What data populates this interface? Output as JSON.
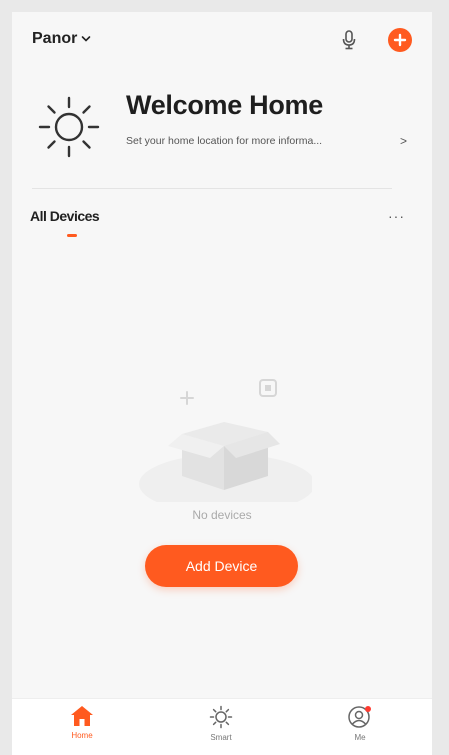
{
  "header": {
    "home_name": "Panor",
    "icons": {
      "dropdown": "chevron-down-icon",
      "mic": "microphone-icon",
      "add": "plus-circle-icon"
    }
  },
  "welcome": {
    "title": "Welcome Home",
    "subtitle": "Set your home location for more informa...",
    "arrow": ">",
    "icon": "sun-icon"
  },
  "devices": {
    "tab_label": "All Devices",
    "more_label": "···",
    "empty_text": "No devices",
    "add_button_label": "Add Device"
  },
  "nav": {
    "items": [
      {
        "label": "Home",
        "icon": "home-icon",
        "active": true
      },
      {
        "label": "Smart",
        "icon": "sun-icon",
        "active": false
      },
      {
        "label": "Me",
        "icon": "user-icon",
        "active": false
      }
    ]
  },
  "colors": {
    "accent": "#ff5a1f",
    "background": "#f7f7f7",
    "nav_background": "#ffffff",
    "text_primary": "#222222",
    "text_muted": "#aaaaaa"
  }
}
